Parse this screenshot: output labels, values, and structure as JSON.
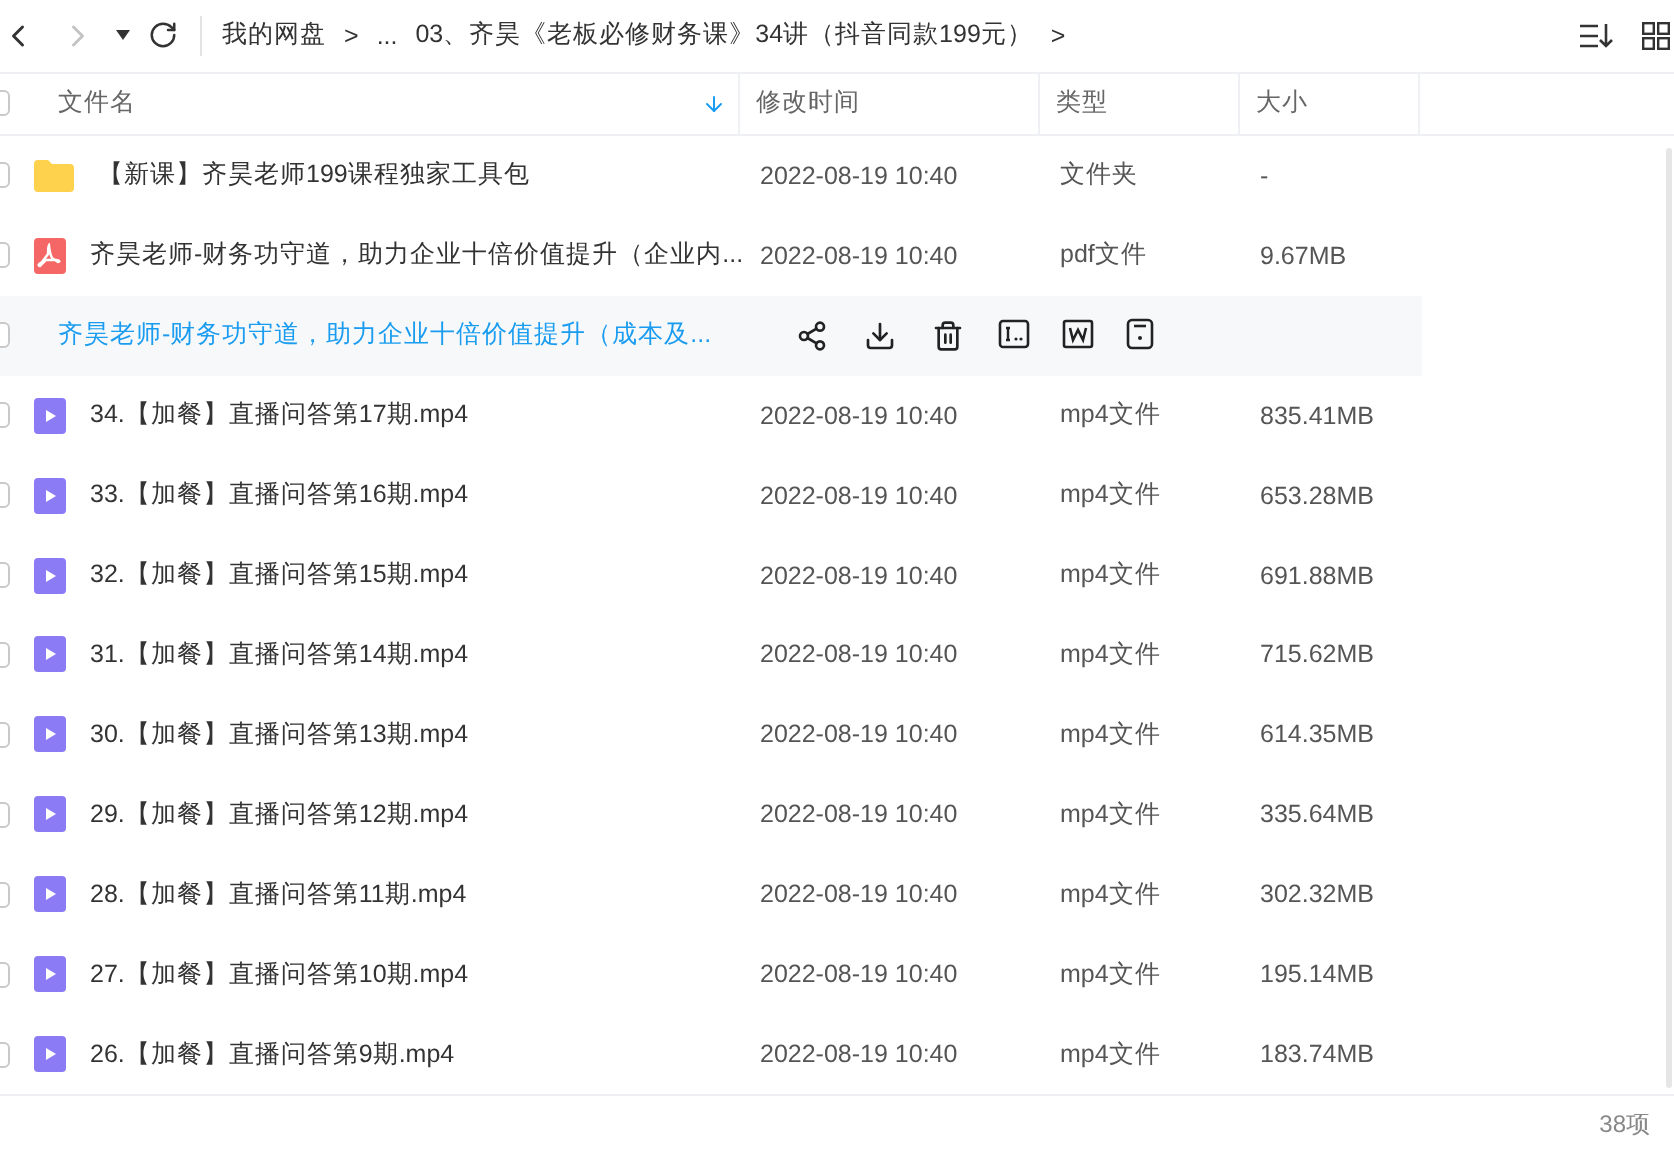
{
  "toolbar": {
    "breadcrumb": [
      "我的网盘",
      ">",
      "...",
      "03、齐昊《老板必修财务课》34讲（抖音同款199元）",
      ">"
    ]
  },
  "table": {
    "select_all_checked": false,
    "columns": [
      {
        "label": "文件名",
        "sorted": true
      },
      {
        "label": "修改时间",
        "sorted": false
      },
      {
        "label": "类型",
        "sorted": false
      },
      {
        "label": "大小",
        "sorted": false
      }
    ],
    "rows": [
      {
        "kind": "folder",
        "name": "【新课】齐昊老师199课程独家工具包",
        "modified": "2022-08-19 10:40",
        "type": "文件夹",
        "size": "-",
        "hovered": false
      },
      {
        "kind": "pdf",
        "name": "齐昊老师-财务功守道，助力企业十倍价值提升（企业内...",
        "modified": "2022-08-19 10:40",
        "type": "pdf文件",
        "size": "9.67MB",
        "hovered": false
      },
      {
        "kind": "pdf",
        "name": "齐昊老师-财务功守道，助力企业十倍价值提升（成本及...",
        "hovered": true
      },
      {
        "kind": "video",
        "name": "34.【加餐】直播问答第17期.mp4",
        "modified": "2022-08-19 10:40",
        "type": "mp4文件",
        "size": "835.41MB",
        "hovered": false
      },
      {
        "kind": "video",
        "name": "33.【加餐】直播问答第16期.mp4",
        "modified": "2022-08-19 10:40",
        "type": "mp4文件",
        "size": "653.28MB",
        "hovered": false
      },
      {
        "kind": "video",
        "name": "32.【加餐】直播问答第15期.mp4",
        "modified": "2022-08-19 10:40",
        "type": "mp4文件",
        "size": "691.88MB",
        "hovered": false
      },
      {
        "kind": "video",
        "name": "31.【加餐】直播问答第14期.mp4",
        "modified": "2022-08-19 10:40",
        "type": "mp4文件",
        "size": "715.62MB",
        "hovered": false
      },
      {
        "kind": "video",
        "name": "30.【加餐】直播问答第13期.mp4",
        "modified": "2022-08-19 10:40",
        "type": "mp4文件",
        "size": "614.35MB",
        "hovered": false
      },
      {
        "kind": "video",
        "name": "29.【加餐】直播问答第12期.mp4",
        "modified": "2022-08-19 10:40",
        "type": "mp4文件",
        "size": "335.64MB",
        "hovered": false
      },
      {
        "kind": "video",
        "name": "28.【加餐】直播问答第11期.mp4",
        "modified": "2022-08-19 10:40",
        "type": "mp4文件",
        "size": "302.32MB",
        "hovered": false
      },
      {
        "kind": "video",
        "name": "27.【加餐】直播问答第10期.mp4",
        "modified": "2022-08-19 10:40",
        "type": "mp4文件",
        "size": "195.14MB",
        "hovered": false
      },
      {
        "kind": "video",
        "name": "26.【加餐】直播问答第9期.mp4",
        "modified": "2022-08-19 10:40",
        "type": "mp4文件",
        "size": "183.74MB",
        "hovered": false
      }
    ]
  },
  "status_bar": {
    "count": "38项"
  }
}
